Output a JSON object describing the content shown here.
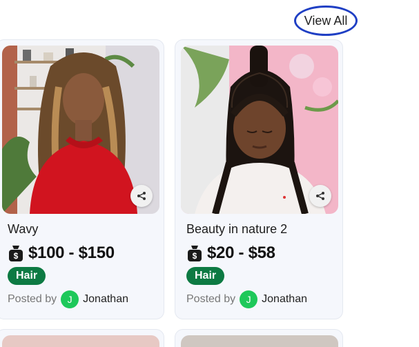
{
  "view_all_label": "View All",
  "cards": [
    {
      "title": "Wavy",
      "price": "$100 - $150",
      "category": "Hair",
      "posted_by_label": "Posted by",
      "avatar_initial": "J",
      "user": "Jonathan"
    },
    {
      "title": "Beauty in nature 2",
      "price": "$20 - $58",
      "category": "Hair",
      "posted_by_label": "Posted by",
      "avatar_initial": "J",
      "user": "Jonathan"
    }
  ],
  "colors": {
    "accent_circle": "#1f3fc4",
    "badge": "#0d7a43",
    "avatar": "#1ec85a"
  }
}
